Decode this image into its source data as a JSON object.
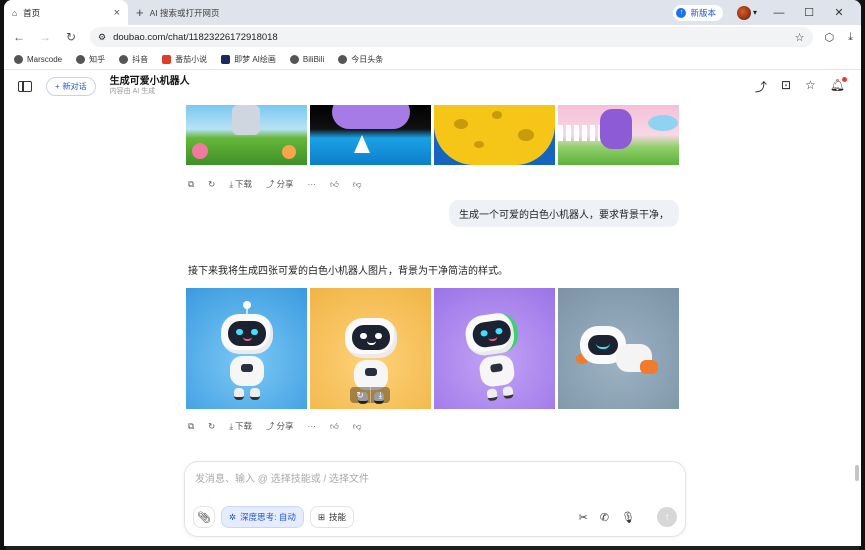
{
  "browser": {
    "tabs": [
      {
        "label": "首页",
        "icon": "home-icon",
        "active": true
      },
      {
        "label": "AI 搜索或打开网页",
        "icon": "plus-icon",
        "active": false
      }
    ],
    "update_label": "新版本",
    "url": "doubao.com/chat/11823226172918018",
    "bookmarks": [
      {
        "label": "Marscode",
        "icon": "globe-icon"
      },
      {
        "label": "知乎",
        "icon": "globe-icon"
      },
      {
        "label": "抖音",
        "icon": "globe-icon"
      },
      {
        "label": "番茄小说",
        "icon": "tomato-icon"
      },
      {
        "label": "即梦 AI绘画",
        "icon": "jimeng-icon"
      },
      {
        "label": "BiliBili",
        "icon": "globe-icon"
      },
      {
        "label": "今日头条",
        "icon": "globe-icon"
      }
    ]
  },
  "header": {
    "new_chat_label": "新对话",
    "title": "生成可爱小机器人",
    "subtitle": "内容由 AI 生成"
  },
  "message_actions": {
    "download": "下载",
    "share": "分享",
    "more": "···"
  },
  "chat": {
    "user_message": "生成一个可爱的白色小机器人，要求背景干净，",
    "ai_message": "接下来我将生成四张可爱的白色小机器人图片，背景为干净简洁的样式。",
    "top_images": [
      "meadow-robot",
      "purple-cloud-sea",
      "cheese-moon",
      "garden-robot"
    ],
    "robot_images": [
      "robot-blue-bg",
      "robot-yellow-bg",
      "robot-purple-bg",
      "robot-grey-bg"
    ]
  },
  "composer": {
    "placeholder": "发消息、输入 @ 选择技能或 / 选择文件",
    "deep_think_label": "深度思考: 自动",
    "skills_label": "技能"
  },
  "colors": {
    "accent": "#2255cc",
    "tab_strip": "#dfe3eb",
    "bubble": "#eef1f6"
  }
}
